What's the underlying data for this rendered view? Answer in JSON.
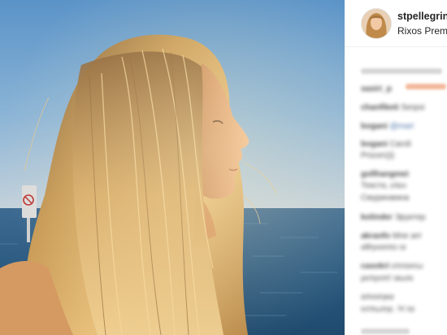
{
  "post": {
    "photo_label": "profile-photo-woman-at-sea",
    "colors": {
      "sky": "#7fb0d8",
      "sea": "#2f5f86",
      "hair": "#c69a58"
    }
  },
  "sidebar": {
    "username": "stpellegrino",
    "location": "Rixos Premium",
    "comments": [
      {
        "user": "sasiri_p",
        "text": ""
      },
      {
        "user": "chanfiketi",
        "text": "Serpoi"
      },
      {
        "user": "bogani",
        "text": "@mari"
      },
      {
        "user": "bogani",
        "text": "Caroli"
      },
      {
        "user": "",
        "text": "Prizom)))"
      },
      {
        "user": "gollhangmei",
        "text": ""
      },
      {
        "user": "",
        "text": "Текстα, ελευ"
      },
      {
        "user": "",
        "text": "Смуринжина"
      },
      {
        "user": "kolinder",
        "text": "Эруктер"
      },
      {
        "user": "akranfo",
        "text": "Мпя зет"
      },
      {
        "user": "",
        "text": "αθηνισιπο οι"
      },
      {
        "user": "casokri",
        "text": "επιτεκτω"
      },
      {
        "user": "",
        "text": "ρεπροπ! αιωτε"
      },
      {
        "user": "",
        "text": "αποσηκα"
      },
      {
        "user": "",
        "text": "ιντπωτηε. Ή τα"
      }
    ]
  }
}
